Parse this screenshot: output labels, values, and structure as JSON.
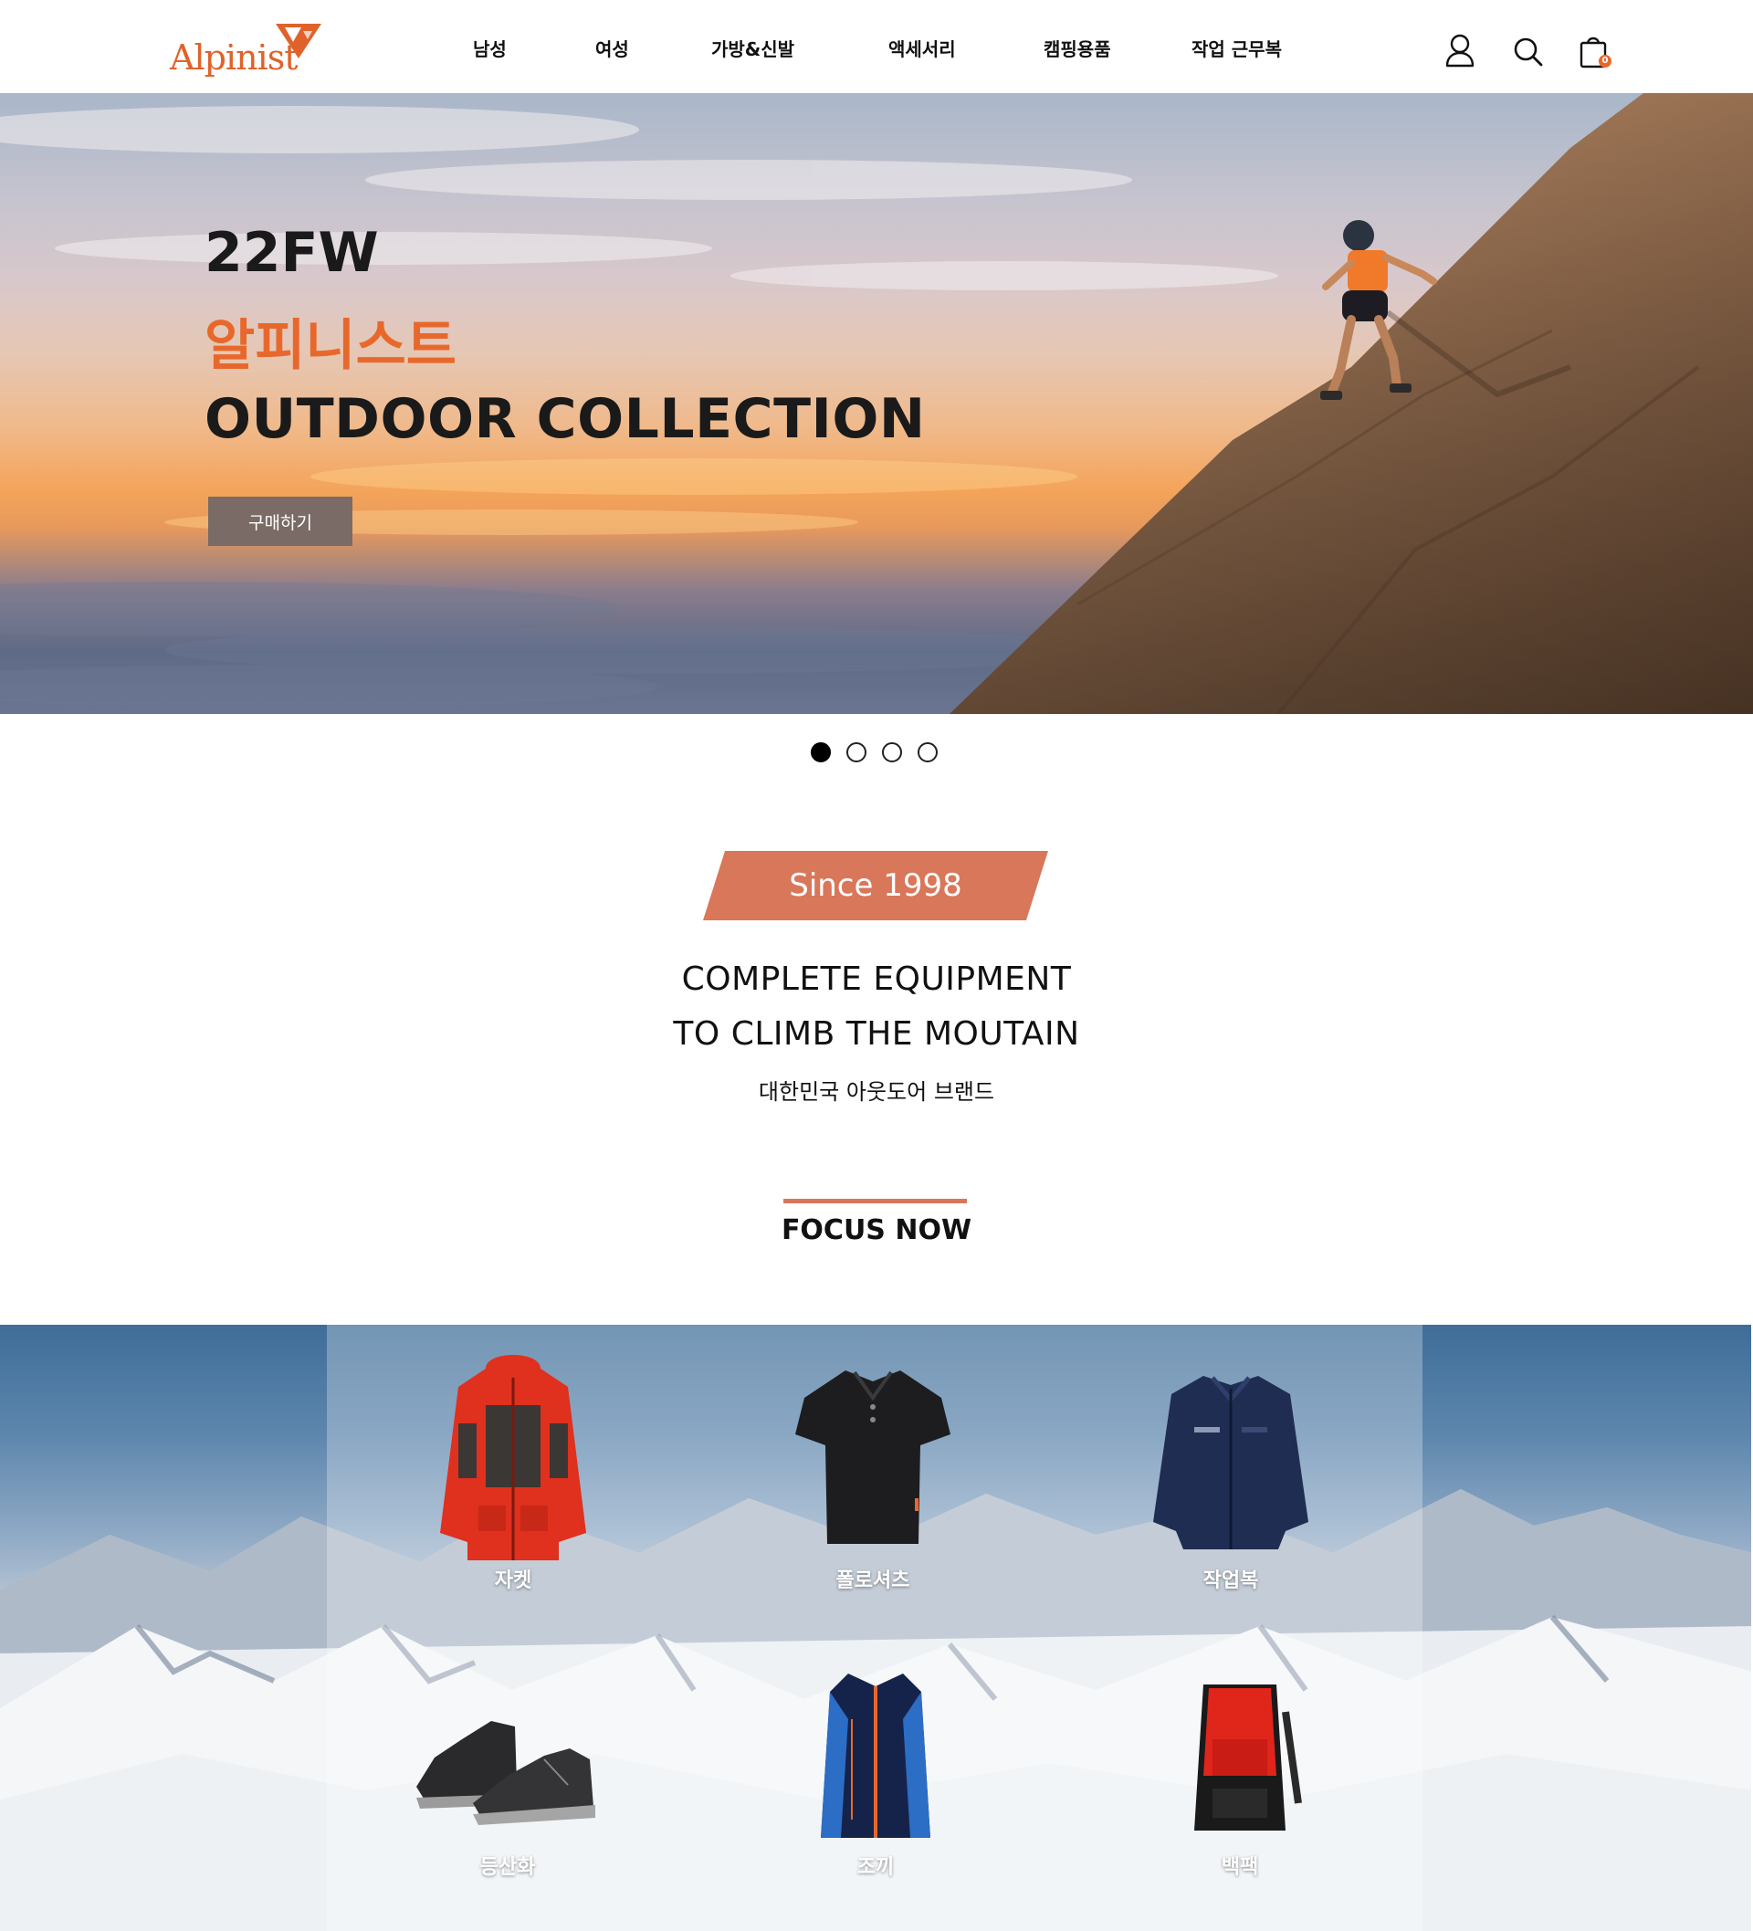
{
  "brand": {
    "name": "Alpinist",
    "color": "#e0622b"
  },
  "nav": {
    "items": [
      "남성",
      "여성",
      "가방&신발",
      "액세서리",
      "캠핑용품",
      "작업 근무복"
    ]
  },
  "header_icons": [
    "user-icon",
    "search-icon",
    "cart-icon"
  ],
  "cart": {
    "count": "0"
  },
  "hero": {
    "line1": "22FW",
    "line2": "알피니스트",
    "line3": "OUTDOOR COLLECTION",
    "cta_label": "구매하기",
    "accent": "#e8682c"
  },
  "carousel": {
    "total": 4,
    "active": 1
  },
  "intro": {
    "badge": "Since 1998",
    "badge_color": "#d9775a",
    "headline1": "COMPLETE EQUIPMENT",
    "headline2": "TO CLIMB THE MOUTAIN",
    "subline": "대한민국 아웃도어 브랜드"
  },
  "focus": {
    "title": "FOCUS NOW",
    "categories": [
      {
        "label": "자켓",
        "icon": "jacket-icon"
      },
      {
        "label": "폴로셔츠",
        "icon": "polo-shirt-icon"
      },
      {
        "label": "작업복",
        "icon": "work-jacket-icon"
      },
      {
        "label": "등산화",
        "icon": "hiking-boots-icon"
      },
      {
        "label": "조끼",
        "icon": "vest-icon"
      },
      {
        "label": "백팩",
        "icon": "backpack-icon"
      }
    ]
  }
}
